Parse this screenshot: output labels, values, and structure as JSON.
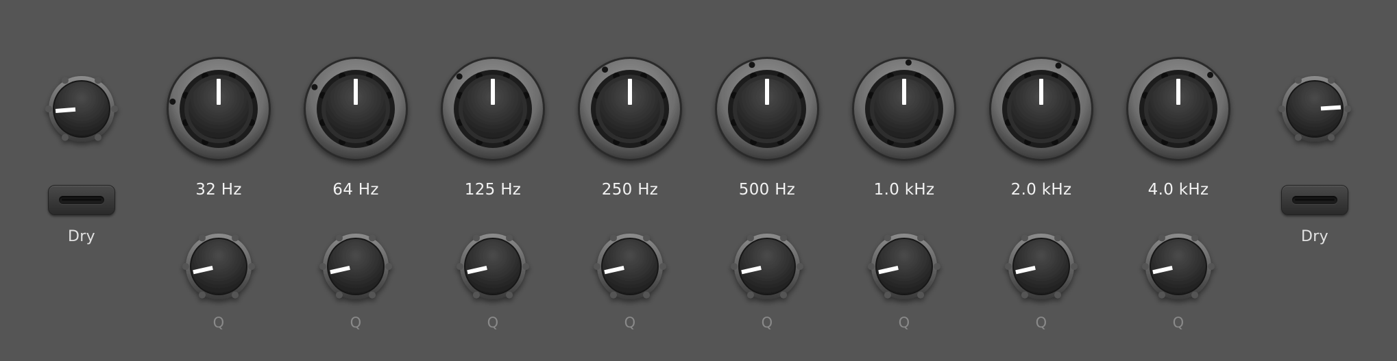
{
  "dry_left": {
    "label": "Dry",
    "knob_value": 0.15
  },
  "dry_right": {
    "label": "Dry",
    "knob_value": 0.82
  },
  "bands": [
    {
      "label": "32 Hz",
      "gain": 0.2,
      "q_label": "Q",
      "q_value": 0.12
    },
    {
      "label": "64 Hz",
      "gain": 0.27,
      "q_label": "Q",
      "q_value": 0.12
    },
    {
      "label": "125 Hz",
      "gain": 0.33,
      "q_label": "Q",
      "q_value": 0.12
    },
    {
      "label": "250 Hz",
      "gain": 0.38,
      "q_label": "Q",
      "q_value": 0.12
    },
    {
      "label": "500 Hz",
      "gain": 0.43,
      "q_label": "Q",
      "q_value": 0.12
    },
    {
      "label": "1.0 kHz",
      "gain": 0.52,
      "q_label": "Q",
      "q_value": 0.12
    },
    {
      "label": "2.0 kHz",
      "gain": 0.58,
      "q_label": "Q",
      "q_value": 0.12
    },
    {
      "label": "4.0 kHz",
      "gain": 0.66,
      "q_label": "Q",
      "q_value": 0.12
    }
  ],
  "colors": {
    "background": "#555555",
    "indicator": "#ffffff",
    "knob": "#2a2a2a"
  }
}
